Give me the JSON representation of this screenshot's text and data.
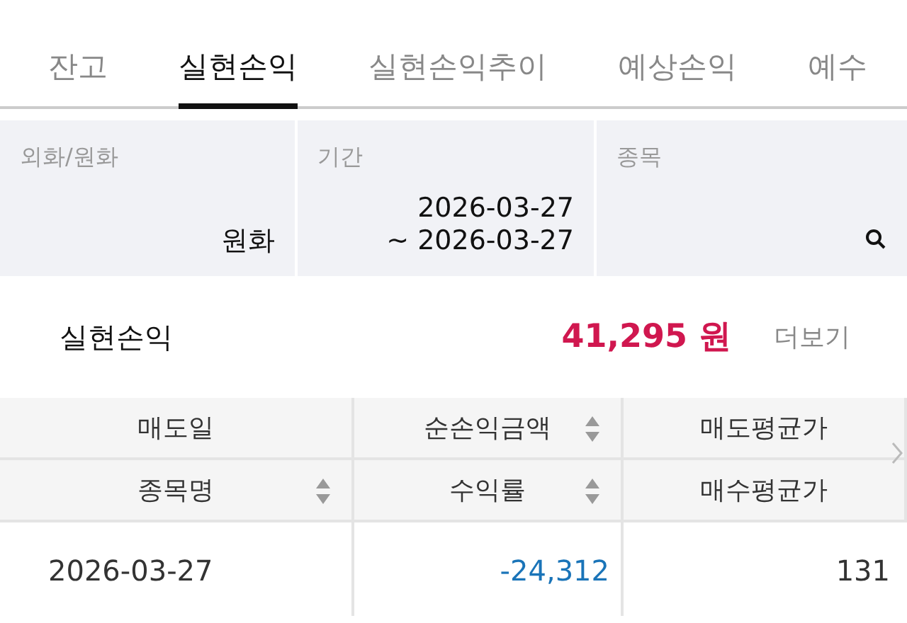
{
  "tabs": [
    {
      "label": "잔고",
      "selected": false
    },
    {
      "label": "실현손익",
      "selected": true
    },
    {
      "label": "실현손익추이",
      "selected": false
    },
    {
      "label": "예상손익",
      "selected": false
    },
    {
      "label": "예수",
      "selected": false
    }
  ],
  "filters": [
    {
      "label": "외화/원화",
      "value": "원화"
    },
    {
      "label": "기간",
      "value": "2026-03-27",
      "value_2": "~ 2026-03-27"
    },
    {
      "label": "종목",
      "kind": "search"
    }
  ],
  "summary": {
    "title": "실현손익",
    "amount": "41,295 원",
    "more": "더보기"
  },
  "table": {
    "header_rows": [
      [
        {
          "label": "매도일",
          "sortable": false
        },
        {
          "label": "순손익금액",
          "sortable": true
        },
        {
          "label": "매도평균가",
          "sortable": false
        }
      ],
      [
        {
          "label": "종목명",
          "sortable": true
        },
        {
          "label": "수익률",
          "sortable": true
        },
        {
          "label": "매수평균가",
          "sortable": false
        }
      ]
    ],
    "rows": [
      {
        "date": "2026-03-27",
        "profit": "-24,312",
        "sell_avg": "131",
        "negative": true
      }
    ]
  }
}
